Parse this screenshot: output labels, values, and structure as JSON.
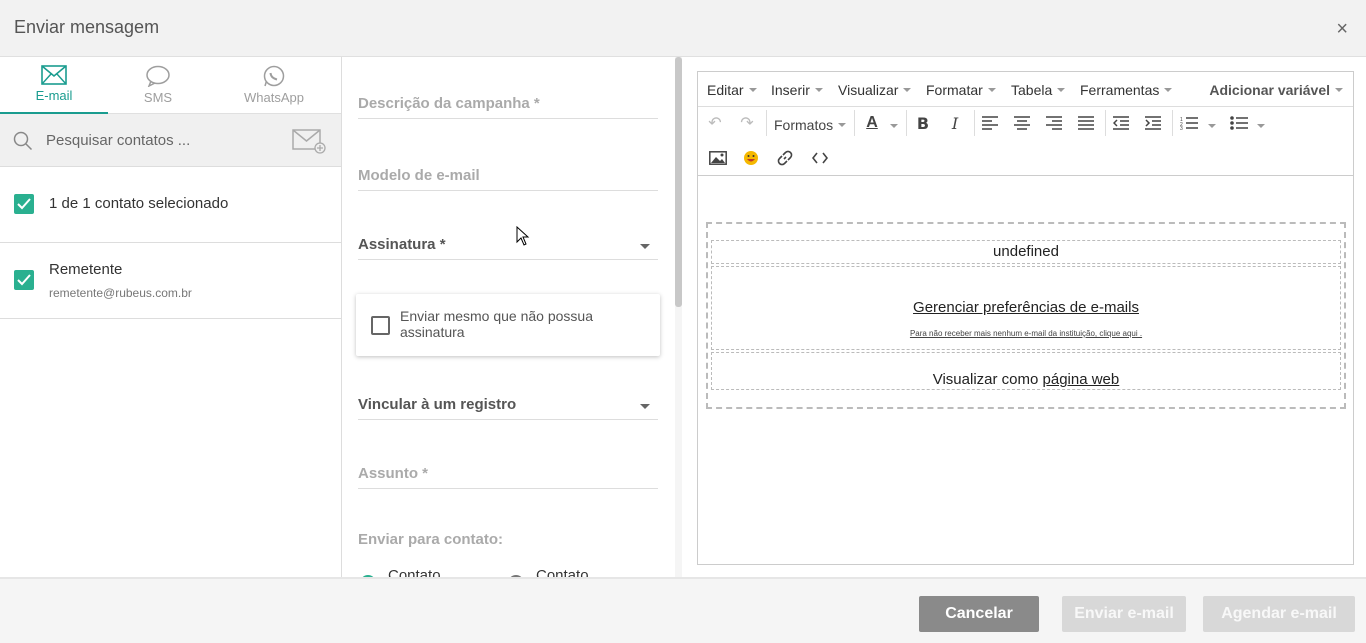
{
  "modal": {
    "title": "Enviar mensagem",
    "close_glyph": "×"
  },
  "tabs": [
    {
      "label": "E-mail",
      "icon": "mail-icon",
      "active": true
    },
    {
      "label": "SMS",
      "icon": "chat-bubble-icon",
      "active": false
    },
    {
      "label": "WhatsApp",
      "icon": "whatsapp-icon",
      "active": false
    }
  ],
  "search": {
    "placeholder": "Pesquisar contatos ..."
  },
  "contacts": {
    "selected_summary": "1 de 1 contato selecionado",
    "sender": {
      "name": "Remetente",
      "email": "remetente@rubeus.com.br"
    }
  },
  "form": {
    "campaign_description": "Descrição da campanha *",
    "email_template": "Modelo de e-mail",
    "signature": "Assinatura *",
    "send_without_signature": "Enviar mesmo que não possua assinatura",
    "link_record": "Vincular à um registro",
    "subject": "Assunto *",
    "send_to_contact": "Enviar para contato:",
    "radio_options": [
      "Contato",
      "Contato"
    ]
  },
  "editor": {
    "menu": [
      "Editar",
      "Inserir",
      "Visualizar",
      "Formatar",
      "Tabela",
      "Ferramentas"
    ],
    "add_variable": "Adicionar variável",
    "formats_label": "Formatos",
    "content": {
      "block1": "undefined",
      "manage_prefs": "Gerenciar preferências de e-mails",
      "unsubscribe": "Para não receber mais nenhum e-mail da instituição, clique aqui .",
      "view_as_prefix": "Visualizar como ",
      "view_as_link": "página web"
    }
  },
  "footer": {
    "cancel": "Cancelar",
    "send": "Enviar e-mail",
    "schedule": "Agendar e-mail"
  },
  "colors": {
    "accent": "#1a9c8f",
    "check": "#2ab090",
    "cancel_button": "#8a8a8a",
    "disabled_button": "#d8d8d8"
  }
}
